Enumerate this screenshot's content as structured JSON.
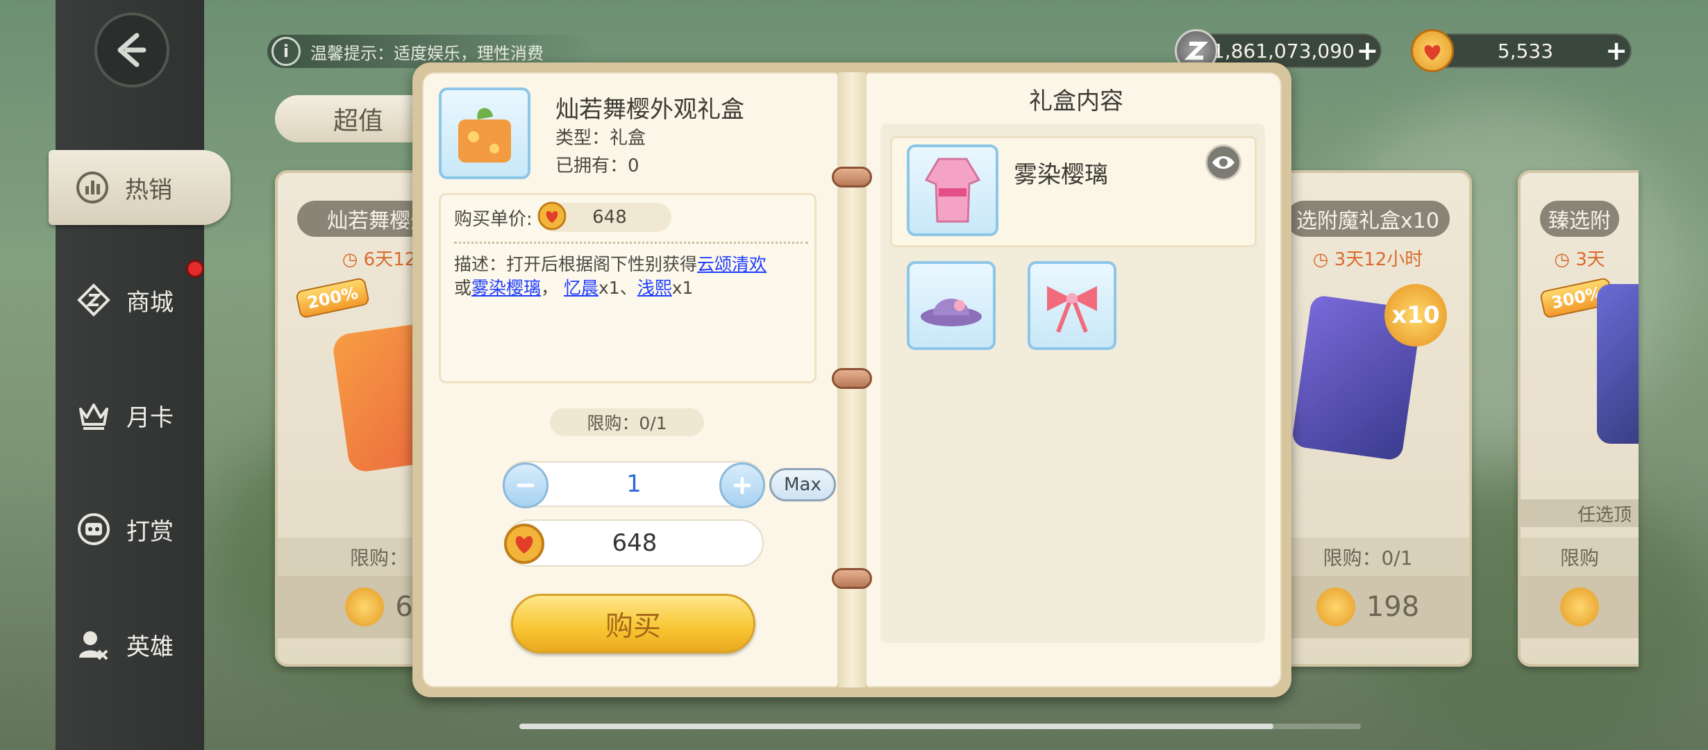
{
  "tip": {
    "icon": "info-icon",
    "text": "温馨提示：适度娱乐，理性消费"
  },
  "currency": {
    "z_coin": {
      "icon": "z-coin-icon",
      "value": "1,861,073,090"
    },
    "gem": {
      "icon": "heart-coin-icon",
      "value": "5,533"
    }
  },
  "sidebar": {
    "items": [
      {
        "label": "热销",
        "icon": "chart-icon",
        "active": true
      },
      {
        "label": "商城",
        "icon": "shop-icon",
        "badge": true
      },
      {
        "label": "月卡",
        "icon": "crown-icon"
      },
      {
        "label": "打赏",
        "icon": "robot-face-icon"
      },
      {
        "label": "英雄",
        "icon": "hero-icon"
      }
    ]
  },
  "shop": {
    "tab": "超值",
    "cards": [
      {
        "name": "灿若舞樱外",
        "time": "6天12",
        "percent": "200%",
        "limit": "限购：",
        "price": "6"
      },
      {
        "name": "选附魔礼盒x10",
        "time": "3天12小时",
        "badge": "x10",
        "limit": "限购：0/1",
        "price": "198"
      },
      {
        "name": "臻选附",
        "time": "3天",
        "percent": "300%",
        "note": "任选顶",
        "limit": "限购",
        "price": ""
      }
    ]
  },
  "detail": {
    "title": "灿若舞樱外观礼盒",
    "type": "类型：礼盒",
    "owned": "已拥有：0",
    "unit_price_label": "购买单价:",
    "unit_price": "648",
    "description": {
      "prefix": "描述：打开后根据阁下性别获得",
      "link1": "云颂清欢",
      "or": "或",
      "link2": "雾染樱璃",
      "sep1": "，",
      "link3": "忆晨",
      "x1a": "x1、",
      "link4": "浅熙",
      "x1b": "x1"
    },
    "limit": "限购：0/1",
    "quantity": "1",
    "max_label": "Max",
    "total": "648",
    "buy_label": "购买"
  },
  "contents": {
    "title": "礼盒内容",
    "main_item": "雾染樱璃"
  },
  "colors": {
    "accent_blue": "#1e3cff",
    "buy_yellow": "#f7c531",
    "badge_red": "#e32b2b"
  }
}
